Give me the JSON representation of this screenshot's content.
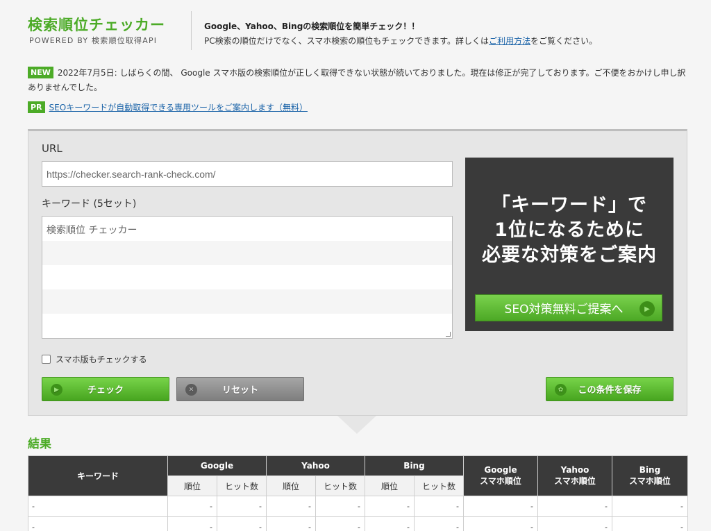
{
  "header": {
    "title": "検索順位チェッカー",
    "subtitle": "POWERED BY 検索順位取得API",
    "tagline": "Google、Yahoo、Bingの検索順位を簡単チェック！！",
    "desc_prefix": "PC検索の順位だけでなく、スマホ検索の順位もチェックできます。詳しくは",
    "desc_link": "ご利用方法",
    "desc_suffix": "をご覧ください。"
  },
  "notices": {
    "new_badge": "NEW",
    "new_text": "2022年7月5日: しばらくの間、 Google スマホ版の検索順位が正しく取得できない状態が続いておりました。現在は修正が完了しております。ご不便をおかけし申し訳ありませんでした。",
    "pr_badge": "PR",
    "pr_link": "SEOキーワードが自動取得できる専用ツールをご案内します（無料）"
  },
  "form": {
    "url_label": "URL",
    "url_value": "https://checker.search-rank-check.com/",
    "keyword_label": "キーワード (5セット)",
    "keyword_placeholder": "検索順位 チェッカー",
    "smartphone_label": "スマホ版もチェックする",
    "check_button": "チェック",
    "reset_button": "リセット",
    "save_button": "この条件を保存"
  },
  "ad": {
    "line1": "「キーワード」で",
    "line2": "1位になるために",
    "line3": "必要な対策をご案内",
    "button": "SEO対策無料ご提案へ"
  },
  "results": {
    "title": "結果",
    "headers": {
      "keyword": "キーワード",
      "google": "Google",
      "yahoo": "Yahoo",
      "bing": "Bing",
      "rank": "順位",
      "hits": "ヒット数",
      "google_sp_1": "Google",
      "google_sp_2": "スマホ順位",
      "yahoo_sp_1": "Yahoo",
      "yahoo_sp_2": "スマホ順位",
      "bing_sp_1": "Bing",
      "bing_sp_2": "スマホ順位"
    },
    "rows": [
      [
        "-",
        "-",
        "-",
        "-",
        "-",
        "-",
        "-",
        "-",
        "-",
        "-"
      ],
      [
        "-",
        "-",
        "-",
        "-",
        "-",
        "-",
        "-",
        "-",
        "-",
        "-"
      ]
    ]
  },
  "colors": {
    "accent_green": "#4cab27",
    "dark_header": "#3a3a3a",
    "link_blue": "#1a63a8"
  }
}
